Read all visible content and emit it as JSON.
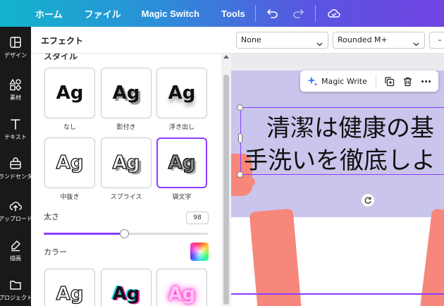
{
  "topbar": {
    "home": "ホーム",
    "file": "ファイル",
    "magic_switch": "Magic Switch",
    "tools": "Tools"
  },
  "rail": [
    {
      "label": "デザイン",
      "icon": "layout-icon"
    },
    {
      "label": "素材",
      "icon": "shapes-icon"
    },
    {
      "label": "テキスト",
      "icon": "text-icon"
    },
    {
      "label": "ブランドセンター",
      "icon": "brand-icon"
    },
    {
      "label": "アップロード",
      "icon": "upload-icon"
    },
    {
      "label": "描画",
      "icon": "draw-icon"
    },
    {
      "label": "プロジェクト",
      "icon": "folder-icon"
    }
  ],
  "panel": {
    "title": "エフェクト",
    "section": "スタイル",
    "styles": [
      {
        "label": "なし",
        "sample": "Ag"
      },
      {
        "label": "影付き",
        "sample": "Ag"
      },
      {
        "label": "浮き出し",
        "sample": "Ag"
      },
      {
        "label": "中抜き",
        "sample": "Ag"
      },
      {
        "label": "スプライス",
        "sample": "Ag"
      },
      {
        "label": "袋文字",
        "sample": "Ag"
      },
      {
        "label": "",
        "sample": "Ag"
      },
      {
        "label": "",
        "sample": "Ag"
      },
      {
        "label": "",
        "sample": "Ag"
      }
    ],
    "selected_style": "袋文字",
    "thickness_label": "太さ",
    "thickness_value": "98",
    "thickness_fraction": 0.49,
    "color_label": "カラー"
  },
  "toolbar": {
    "effect_select": "None",
    "font_select": "Rounded M+",
    "size_select": "–"
  },
  "floatbar": {
    "magic_write": "Magic Write"
  },
  "canvas": {
    "line1": "清潔は健康の基",
    "line2": "手洗いを徹底しよ"
  },
  "colors": {
    "accent": "#8b3dff",
    "band": "#c9c5ec",
    "skin": "#f7877a"
  }
}
